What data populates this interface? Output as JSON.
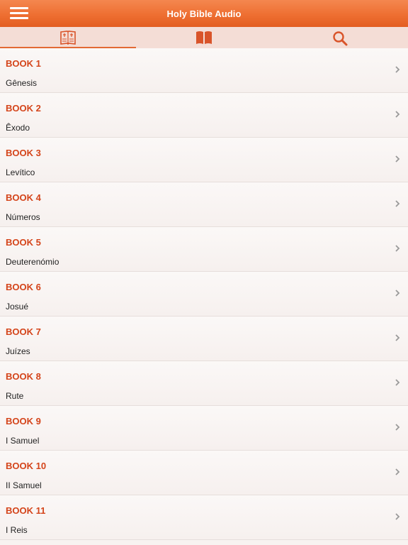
{
  "header": {
    "title": "Holy Bible Audio",
    "menu_icon": "hamburger-menu-icon"
  },
  "tabs": [
    {
      "icon": "open-bible-icon",
      "active": true
    },
    {
      "icon": "closed-book-icon",
      "active": false
    },
    {
      "icon": "search-icon",
      "active": false
    }
  ],
  "colors": {
    "header": "#ee6f32",
    "accent": "#d4441a",
    "tab_icon": "#d9542a"
  },
  "books": [
    {
      "label": "BOOK 1",
      "name": "Gênesis"
    },
    {
      "label": "BOOK 2",
      "name": "Êxodo"
    },
    {
      "label": "BOOK 3",
      "name": "Levítico"
    },
    {
      "label": "BOOK 4",
      "name": "Números"
    },
    {
      "label": "BOOK 5",
      "name": "Deuterenómio"
    },
    {
      "label": "BOOK 6",
      "name": "Josué"
    },
    {
      "label": "BOOK 7",
      "name": "Juízes"
    },
    {
      "label": "BOOK 8",
      "name": "Rute"
    },
    {
      "label": "BOOK 9",
      "name": "I Samuel"
    },
    {
      "label": "BOOK 10",
      "name": "II Samuel"
    },
    {
      "label": "BOOK 11",
      "name": "I Reis"
    }
  ]
}
